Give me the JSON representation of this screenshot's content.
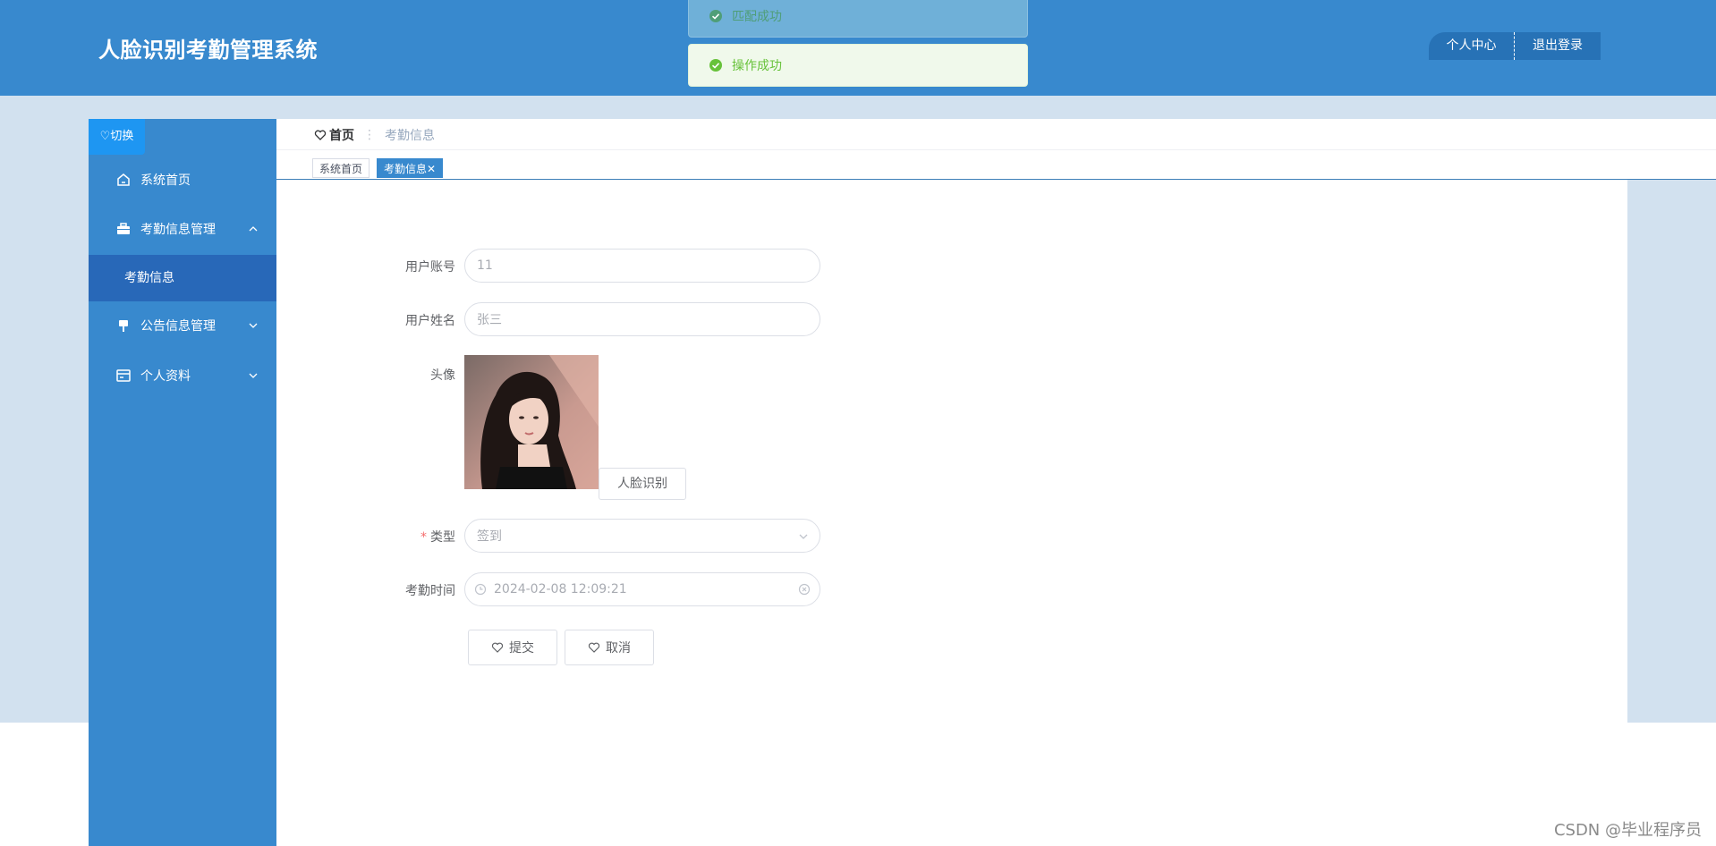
{
  "header": {
    "title": "人脸识别考勤管理系统",
    "profile_label": "个人中心",
    "logout_label": "退出登录",
    "bg_color": "#3889ce"
  },
  "toasts": [
    {
      "text": "匹配成功",
      "icon": "check-circle-icon"
    },
    {
      "text": "操作成功",
      "icon": "check-circle-icon"
    }
  ],
  "sidebar": {
    "switch_label": "♡切换",
    "items": [
      {
        "label": "系统首页",
        "icon": "home-icon"
      },
      {
        "label": "考勤信息管理",
        "icon": "briefcase-icon",
        "expanded": true
      },
      {
        "label": "公告信息管理",
        "icon": "notice-icon"
      },
      {
        "label": "个人资料",
        "icon": "profile-card-icon"
      }
    ],
    "sub_items": [
      {
        "label": "考勤信息"
      }
    ]
  },
  "breadcrumb": {
    "home": "首页",
    "current": "考勤信息"
  },
  "tags": {
    "home": "系统首页",
    "active": "考勤信息"
  },
  "form": {
    "account_label": "用户账号",
    "account_value": "11",
    "name_label": "用户姓名",
    "name_value": "张三",
    "avatar_label": "头像",
    "face_button": "人脸识别",
    "type_label": "类型",
    "type_value": "签到",
    "time_label": "考勤时间",
    "time_value": "2024-02-08 12:09:21",
    "submit_label": "提交",
    "cancel_label": "取消"
  },
  "watermark": "CSDN @毕业程序员",
  "colors": {
    "primary": "#3889ce",
    "sidebar_active": "#2868b8",
    "page_bg": "#d2e1ef",
    "success": "#67c23a"
  }
}
